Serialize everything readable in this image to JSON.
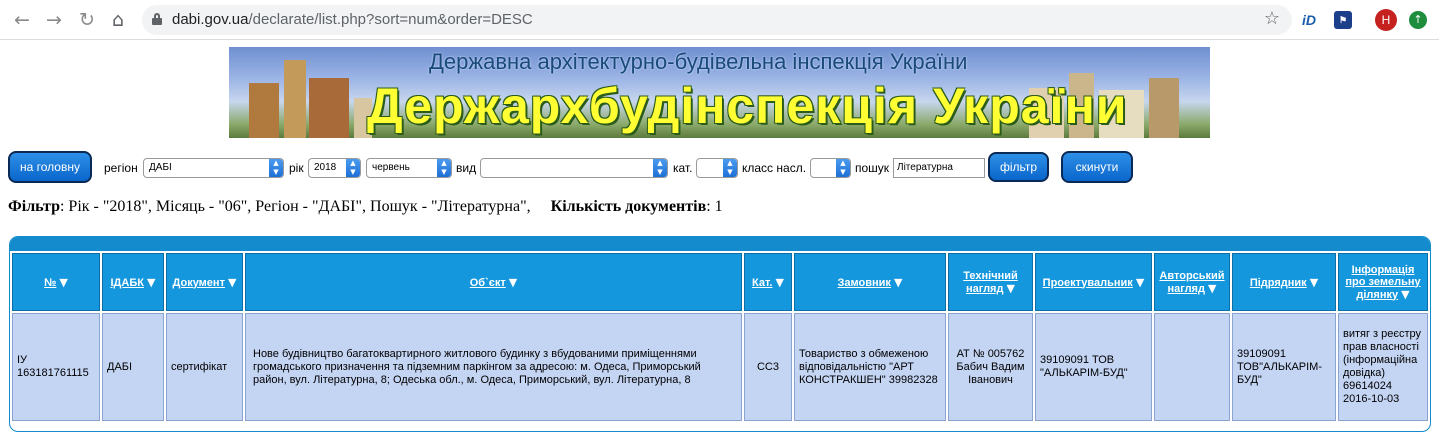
{
  "browser": {
    "url_domain": "dabi.gov.ua",
    "url_path": "/declarate/list.php?sort=num&order=DESC",
    "avatar_letter": "H",
    "ext_id_label": "iD"
  },
  "banner": {
    "subtitle": "Державна архітектурно-будівельна інспекція України",
    "title": "Держархбудінспекція України"
  },
  "filters": {
    "home_button": "на головну",
    "region_label": "регіон",
    "region_value": "ДАБІ",
    "year_label": "рік",
    "year_value": "2018",
    "month_value": "червень",
    "type_label": "вид",
    "type_value": "",
    "cat_label": "кат.",
    "cat_value": "",
    "class_label": "класс насл.",
    "class_value": "",
    "search_label": "пошук",
    "search_value": "Літературна",
    "filter_button": "фільтр",
    "reset_button": "скинути"
  },
  "summary": {
    "filter_label": "Фільтр",
    "filter_text": ": Рік - \"2018\", Місяць - \"06\", Регіон - \"ДАБІ\", Пошук - \"Літературна\",",
    "count_label": "Кількість документів",
    "count_value": ": 1"
  },
  "table": {
    "headers": [
      {
        "l1": "№",
        "l2": ""
      },
      {
        "l1": "ІДАБК",
        "l2": ""
      },
      {
        "l1": "Документ",
        "l2": ""
      },
      {
        "l1": "Об`єкт",
        "l2": ""
      },
      {
        "l1": "Кат.",
        "l2": ""
      },
      {
        "l1": "Замовник",
        "l2": ""
      },
      {
        "l1": "Технічний",
        "l2": "нагляд"
      },
      {
        "l1": "Проектувальник",
        "l2": ""
      },
      {
        "l1": "Авторський",
        "l2": "нагляд"
      },
      {
        "l1": "Підрядник",
        "l2": ""
      },
      {
        "l1": "Інформація",
        "l2": "про земельну",
        "l3": "ділянку"
      }
    ],
    "rows": [
      {
        "num": "ІУ 163181761115",
        "idabk": "ДАБІ",
        "doc": "сертифікат",
        "object": "Нове будівництво багатоквартирного житлового будинку з вбудованими приміщеннями громадського призначення та підземним паркінгом за адресою: м. Одеса, Приморський район, вул. Літературна, 8; Одеська обл., м. Одеса, Приморський, вул. Літературна, 8",
        "cat": "СС3",
        "customer": "Товариство з обмеженою відповідальністю \"АРТ КОНСТРАКШЕН\" 39982328",
        "tech": "АТ № 005762 Бабич Вадим Іванович",
        "designer": "39109091 ТОВ \"АЛЬКАРІМ-БУД\"",
        "author": "",
        "contractor": "39109091 ТОВ\"АЛЬКАРІМ-БУД\"",
        "land": "витяг з реєстру прав власності (інформаційна довідка) 69614024 2016-10-03"
      }
    ]
  }
}
